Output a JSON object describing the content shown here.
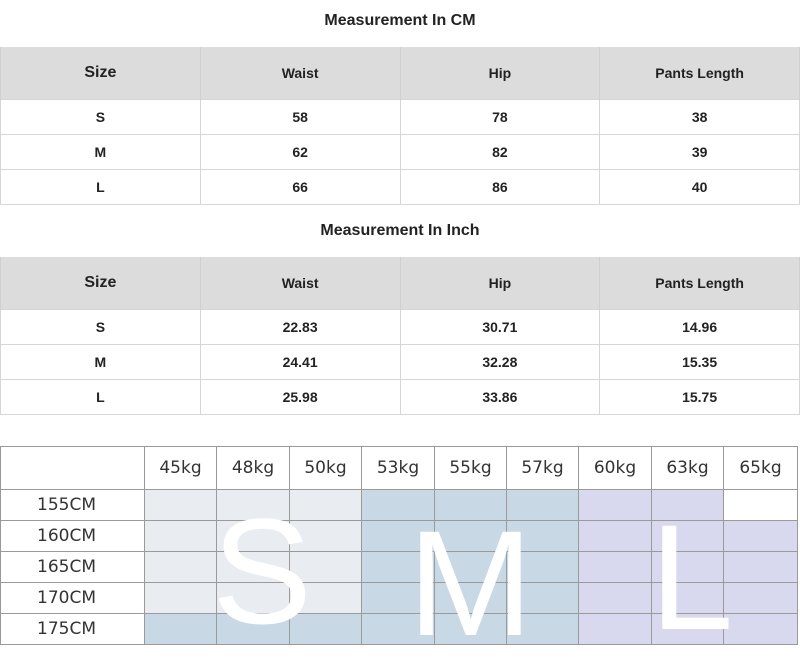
{
  "cm_section": {
    "title": "Measurement In CM",
    "headers": [
      "Size",
      "Waist",
      "Hip",
      "Pants Length"
    ],
    "rows": [
      [
        "S",
        "58",
        "78",
        "38"
      ],
      [
        "M",
        "62",
        "82",
        "39"
      ],
      [
        "L",
        "66",
        "86",
        "40"
      ]
    ]
  },
  "inch_section": {
    "title": "Measurement In Inch",
    "headers": [
      "Size",
      "Waist",
      "Hip",
      "Pants Length"
    ],
    "rows": [
      [
        "S",
        "22.83",
        "30.71",
        "14.96"
      ],
      [
        "M",
        "24.41",
        "32.28",
        "15.35"
      ],
      [
        "L",
        "25.98",
        "33.86",
        "15.75"
      ]
    ]
  },
  "size_grid": {
    "weights": [
      "45kg",
      "48kg",
      "50kg",
      "53kg",
      "55kg",
      "57kg",
      "60kg",
      "63kg",
      "65kg"
    ],
    "heights": [
      "155CM",
      "160CM",
      "165CM",
      "170CM",
      "175CM"
    ],
    "size_letters": {
      "s": "S",
      "m": "M",
      "l": "L"
    },
    "colors": {
      "s_zone": "#e9edf2",
      "m_zone": "#c8d8e4",
      "l_zone": "#d8d8ee"
    }
  }
}
